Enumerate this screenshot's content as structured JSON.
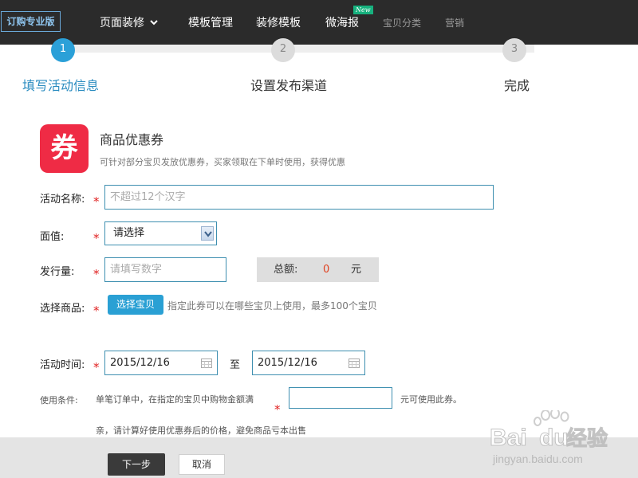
{
  "topnav": {
    "logo": "订购专业版",
    "items": [
      {
        "label": "页面装修"
      },
      {
        "label": "模板管理"
      },
      {
        "label": "装修模板"
      },
      {
        "label": "微海报",
        "badge": "New"
      },
      {
        "label": "宝贝分类"
      },
      {
        "label": "营销"
      }
    ]
  },
  "steps": [
    {
      "num": "1",
      "label": "填写活动信息",
      "active": true
    },
    {
      "num": "2",
      "label": "设置发布渠道"
    },
    {
      "num": "3",
      "label": "完成"
    }
  ],
  "coupon": {
    "icon_char": "券",
    "title": "商品优惠券",
    "desc": "可针对部分宝贝发放优惠券，买家领取在下单时使用，获得优惠"
  },
  "form": {
    "required_mark": "*",
    "name_label": "活动名称:",
    "name_placeholder": "不超过12个汉字",
    "face_label": "面值:",
    "face_selected": "请选择",
    "qty_label": "发行量:",
    "qty_placeholder": "请填写数字",
    "total_label": "总额:",
    "total_value": "0",
    "total_unit": "元",
    "goods_label": "选择商品:",
    "goods_button": "选择宝贝",
    "goods_hint": "指定此券可以在哪些宝贝上使用，最多100个宝贝",
    "time_label": "活动时间:",
    "start_date": "2015/12/16",
    "to_text": "至",
    "end_date": "2015/12/16",
    "cond_label": "使用条件:",
    "cond_text": "单笔订单中，在指定的宝贝中购物金额满",
    "cond_suffix": "元可使用此券。",
    "cond_note": "亲，请计算好使用优惠券后的价格，避免商品亏本出售"
  },
  "actions": {
    "next": "下一步",
    "cancel": "取消"
  },
  "watermark": {
    "brand": "Bai",
    "brand2": "du",
    "cn": "经验",
    "url": "jingyan.baidu.com"
  },
  "colors": {
    "nav_bg": "#2b2b2b",
    "accent": "#2ba0d8",
    "coupon_red": "#ef2b45",
    "required_red": "#e02020"
  }
}
